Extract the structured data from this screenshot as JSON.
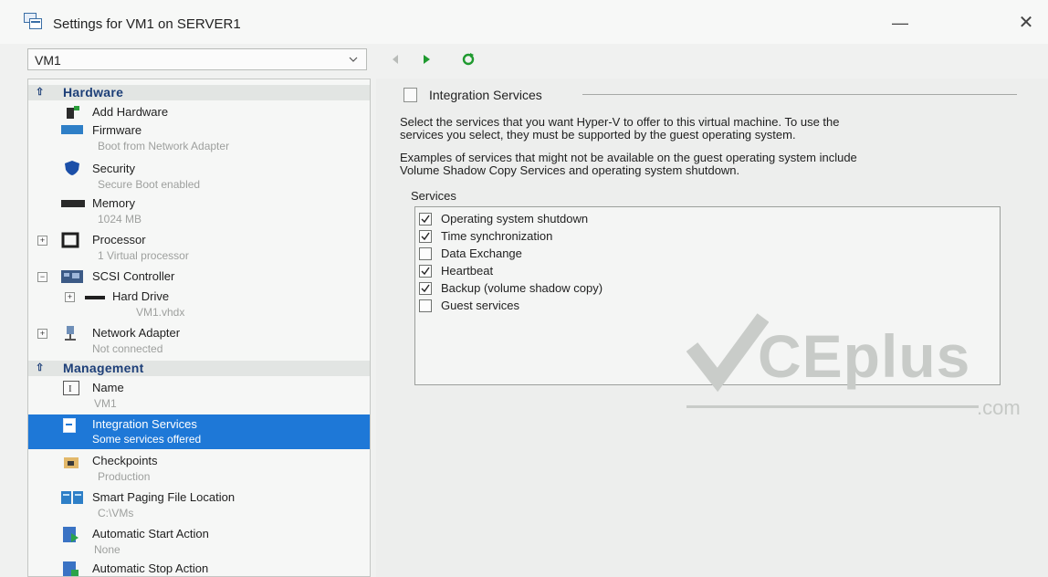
{
  "window": {
    "title": "Settings for VM1 on SERVER1",
    "minimize": "—",
    "close": "✕"
  },
  "vm_selector": {
    "value": "VM1"
  },
  "nav": {
    "back_icon": "back-arrow-icon",
    "forward_icon": "play-icon",
    "refresh_icon": "refresh-icon",
    "accent": "#1f9a2f"
  },
  "sidebar": {
    "sections": [
      {
        "label": "Hardware"
      },
      {
        "label": "Management"
      }
    ],
    "hardware": [
      {
        "label": "Add Hardware",
        "sub": ""
      },
      {
        "label": "Firmware",
        "sub": "Boot from Network Adapter"
      },
      {
        "label": "Security",
        "sub": "Secure Boot enabled"
      },
      {
        "label": "Memory",
        "sub": "1024 MB"
      },
      {
        "label": "Processor",
        "sub": "1 Virtual processor"
      },
      {
        "label": "SCSI Controller",
        "sub": ""
      },
      {
        "label": "Hard Drive",
        "sub": "VM1.vhdx"
      },
      {
        "label": "Network Adapter",
        "sub": "Not connected"
      }
    ],
    "management": [
      {
        "label": "Name",
        "sub": "VM1"
      },
      {
        "label": "Integration Services",
        "sub": "Some services offered"
      },
      {
        "label": "Checkpoints",
        "sub": "Production"
      },
      {
        "label": "Smart Paging File Location",
        "sub": "C:\\VMs"
      },
      {
        "label": "Automatic Start Action",
        "sub": "None"
      },
      {
        "label": "Automatic Stop Action",
        "sub": ""
      }
    ],
    "selected_color": "#1e78d7"
  },
  "main": {
    "group_title": "Integration Services",
    "para1_line1": "Select the services that you want Hyper-V to offer to this virtual machine. To use the",
    "para1_line2": "services you select, they must be supported by the guest operating system.",
    "para2_line1": "Examples of services that might not be available on the guest operating system include",
    "para2_line2": "Volume Shadow Copy Services and operating system shutdown.",
    "services_label": "Services",
    "services": [
      {
        "label": "Operating system shutdown",
        "checked": true
      },
      {
        "label": "Time synchronization",
        "checked": true
      },
      {
        "label": "Data Exchange",
        "checked": false
      },
      {
        "label": "Heartbeat",
        "checked": true
      },
      {
        "label": "Backup (volume shadow copy)",
        "checked": true
      },
      {
        "label": "Guest services",
        "checked": false
      }
    ]
  },
  "watermark": {
    "text": "CEplus",
    "suffix": ".com"
  }
}
